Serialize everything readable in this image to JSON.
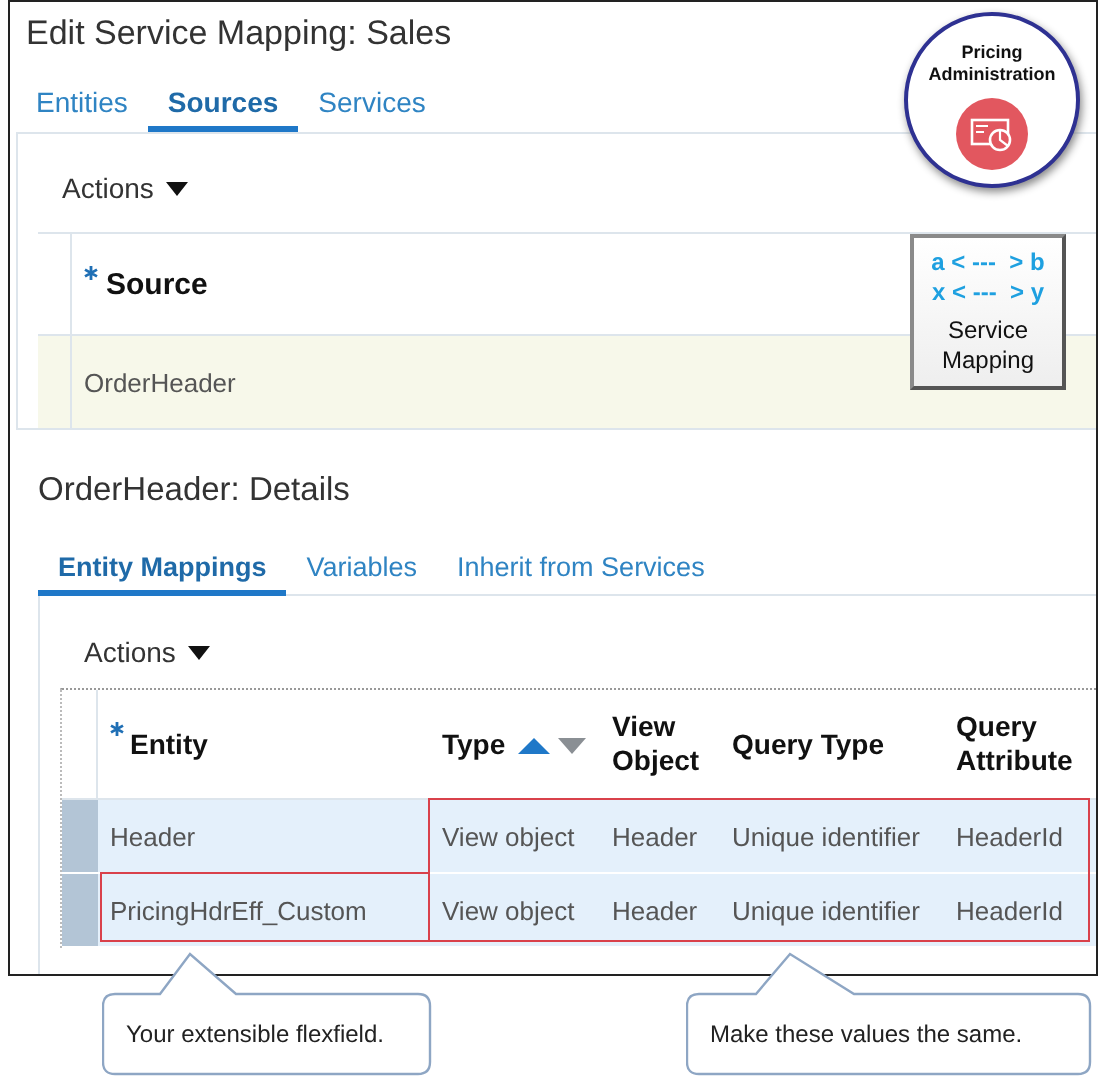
{
  "title": "Edit Service Mapping: Sales",
  "tabs": [
    {
      "label": "Entities",
      "selected": false
    },
    {
      "label": "Sources",
      "selected": true
    },
    {
      "label": "Services",
      "selected": false
    }
  ],
  "badge": {
    "title": "Pricing Administration"
  },
  "service_mapping_card": {
    "lines": [
      "a < ---  > b",
      "x < ---  > y"
    ],
    "label": "Service Mapping"
  },
  "sources": {
    "actions": "Actions",
    "column": {
      "label": "Source",
      "required": true
    },
    "rows": [
      {
        "source": "OrderHeader",
        "selected": true
      }
    ]
  },
  "details": {
    "title": "OrderHeader: Details",
    "tabs": [
      {
        "label": "Entity Mappings",
        "selected": true
      },
      {
        "label": "Variables",
        "selected": false
      },
      {
        "label": "Inherit from Services",
        "selected": false
      }
    ],
    "actions": "Actions",
    "columns": [
      {
        "label": "Entity",
        "required": true
      },
      {
        "label": "Type",
        "required": false,
        "sort_ascending": true
      },
      {
        "label": "View Object",
        "required": false
      },
      {
        "label": "Query Type",
        "required": false
      },
      {
        "label": "Query Attribute",
        "required": false
      }
    ],
    "rows": [
      {
        "selected": true,
        "cells": [
          "Header",
          "View object",
          "Header",
          "Unique identifier",
          "HeaderId"
        ]
      },
      {
        "selected": true,
        "cells": [
          "PricingHdrEff_Custom",
          "View object",
          "Header",
          "Unique identifier",
          "HeaderId"
        ]
      }
    ]
  },
  "callouts": [
    {
      "text": "Your extensible flexfield."
    },
    {
      "text": "Make these values the same."
    }
  ]
}
